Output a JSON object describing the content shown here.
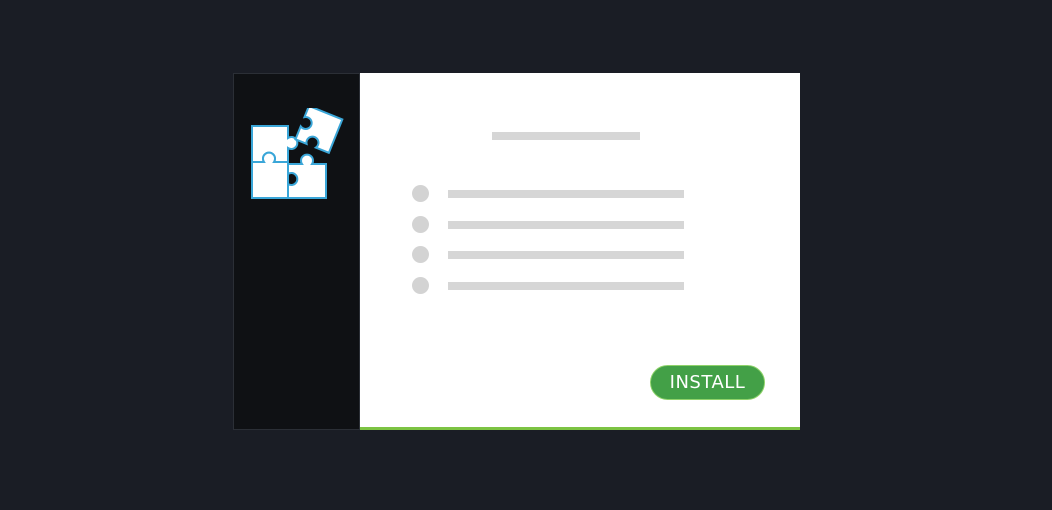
{
  "installer": {
    "sidebar": {
      "icon": "puzzle-pieces-icon",
      "icon_color": "#bfe8f7",
      "icon_outline": "#3aa6d8"
    },
    "content": {
      "title_placeholder": "",
      "list_items": [
        "",
        "",
        "",
        ""
      ]
    },
    "install_button": {
      "label": "INSTALL",
      "color": "#43a047"
    },
    "accent_color": "#7cc343"
  }
}
